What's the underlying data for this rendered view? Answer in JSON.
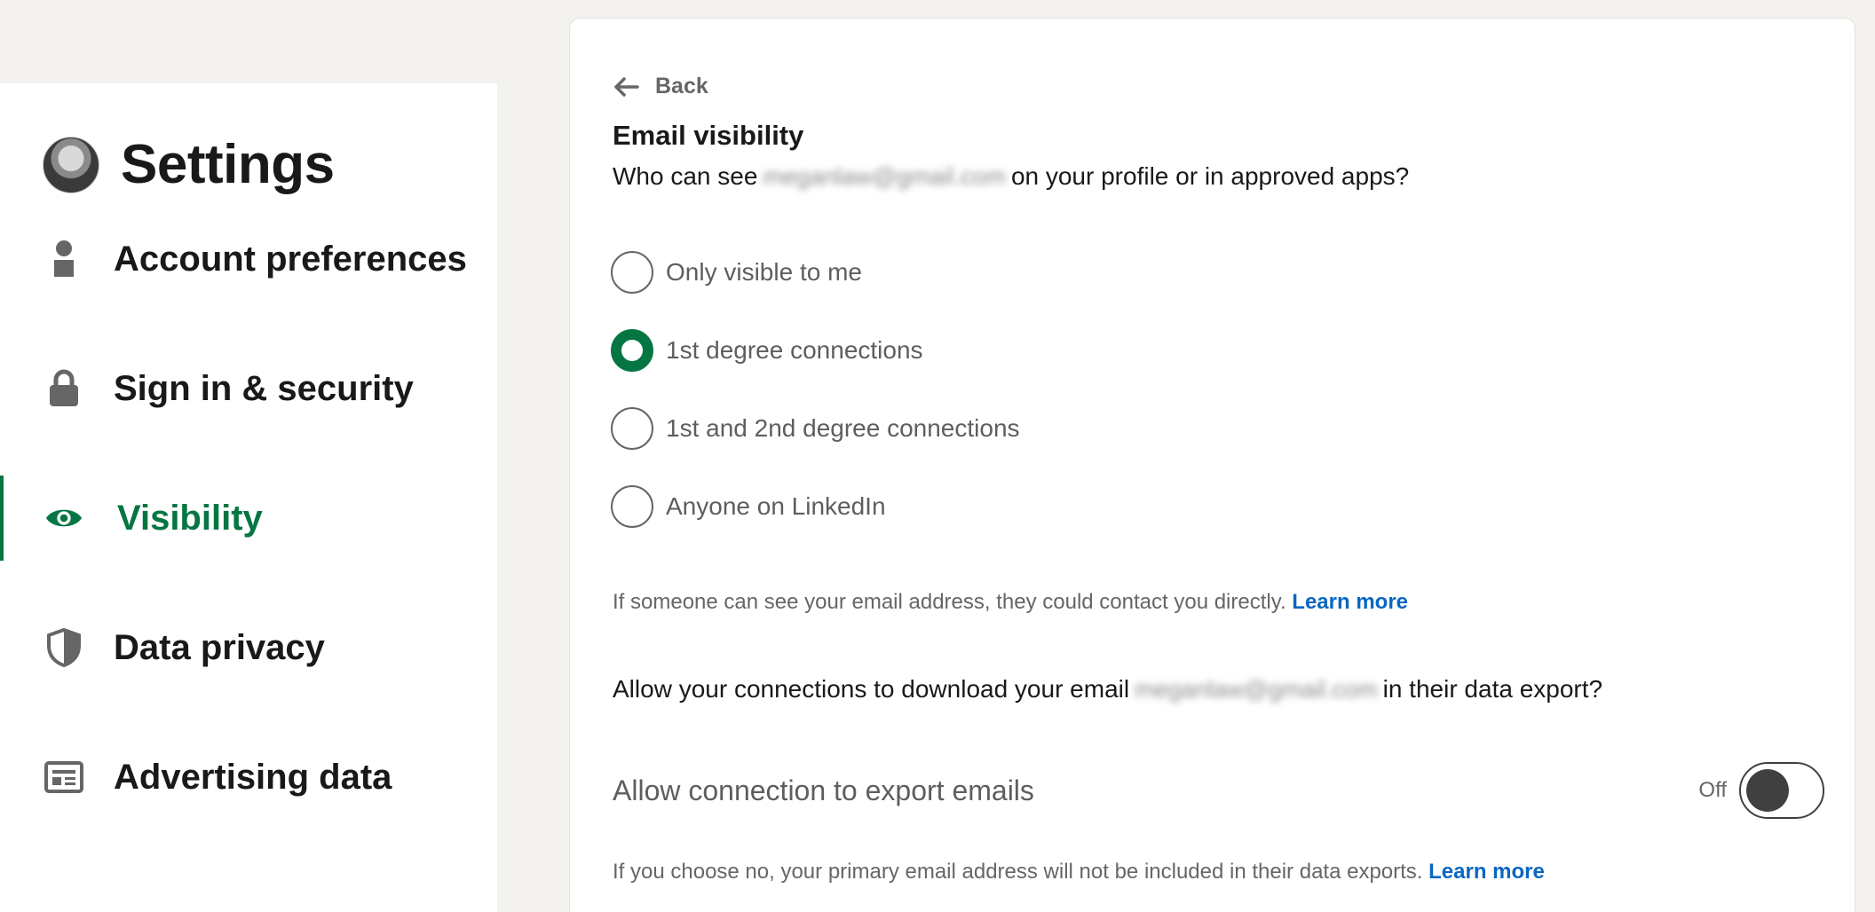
{
  "sidebar": {
    "title": "Settings",
    "items": [
      {
        "label": "Account preferences",
        "icon": "person-icon"
      },
      {
        "label": "Sign in & security",
        "icon": "lock-icon"
      },
      {
        "label": "Visibility",
        "icon": "eye-icon",
        "active": true
      },
      {
        "label": "Data privacy",
        "icon": "shield-icon"
      },
      {
        "label": "Advertising data",
        "icon": "ad-card-icon"
      }
    ]
  },
  "main": {
    "back_label": "Back",
    "section_title": "Email visibility",
    "question_prefix": "Who can see",
    "question_email": "meganlaw@gmail.com",
    "question_suffix": "on your profile or in approved apps?",
    "options": [
      {
        "label": "Only visible to me",
        "checked": false
      },
      {
        "label": "1st degree connections",
        "checked": true
      },
      {
        "label": "1st and 2nd degree connections",
        "checked": false
      },
      {
        "label": "Anyone on LinkedIn",
        "checked": false
      }
    ],
    "help_text_1": "If someone can see your email address, they could contact you directly.",
    "learn_more_1": "Learn more",
    "export_question_prefix": "Allow your connections to download your email",
    "export_question_email": "meganlaw@gmail.com",
    "export_question_suffix": "in their data export?",
    "toggle_label": "Allow connection to export emails",
    "toggle_state": "Off",
    "help_text_2": "If you choose no, your primary email address will not be included in their data exports.",
    "learn_more_2": "Learn more"
  },
  "colors": {
    "accent_green": "#057642",
    "link_blue": "#0a66c2",
    "background": "#f3f2ef"
  }
}
